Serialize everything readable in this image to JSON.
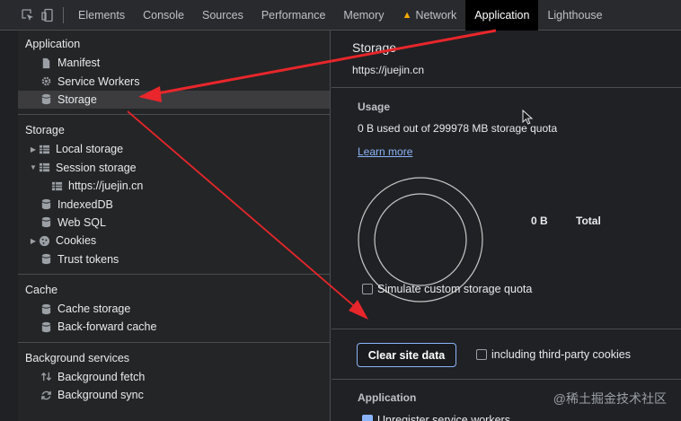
{
  "toolbar": {
    "tabs": [
      {
        "label": "Elements"
      },
      {
        "label": "Console"
      },
      {
        "label": "Sources"
      },
      {
        "label": "Performance"
      },
      {
        "label": "Memory"
      },
      {
        "label": "Network"
      },
      {
        "label": "Application"
      },
      {
        "label": "Lighthouse"
      }
    ],
    "active_tab": "Application"
  },
  "sidebar": {
    "application": {
      "heading": "Application",
      "items": [
        {
          "label": "Manifest",
          "icon": "file-icon"
        },
        {
          "label": "Service Workers",
          "icon": "gear-icon"
        },
        {
          "label": "Storage",
          "icon": "database-icon",
          "selected": true
        }
      ]
    },
    "storage": {
      "heading": "Storage",
      "items": [
        {
          "label": "Local storage",
          "icon": "grid-icon",
          "expander": "collapsed"
        },
        {
          "label": "Session storage",
          "icon": "grid-icon",
          "expander": "expanded"
        },
        {
          "label": "https://juejin.cn",
          "icon": "grid-icon",
          "child": true
        },
        {
          "label": "IndexedDB",
          "icon": "database-icon"
        },
        {
          "label": "Web SQL",
          "icon": "database-icon"
        },
        {
          "label": "Cookies",
          "icon": "cookie-icon",
          "expander": "collapsed"
        },
        {
          "label": "Trust tokens",
          "icon": "database-icon"
        }
      ]
    },
    "cache": {
      "heading": "Cache",
      "items": [
        {
          "label": "Cache storage",
          "icon": "database-icon"
        },
        {
          "label": "Back-forward cache",
          "icon": "database-icon"
        }
      ]
    },
    "background": {
      "heading": "Background services",
      "items": [
        {
          "label": "Background fetch",
          "icon": "arrows-updown-icon"
        },
        {
          "label": "Background sync",
          "icon": "sync-icon"
        }
      ]
    }
  },
  "main": {
    "title": "Storage",
    "origin": "https://juejin.cn",
    "usage": {
      "heading": "Usage",
      "text": "0 B used out of 299978 MB storage quota",
      "learn_more": "Learn more",
      "legend_value": "0 B",
      "legend_label": "Total"
    },
    "simulate_quota_label": "Simulate custom storage quota",
    "clear_button": "Clear site data",
    "third_party_label": "including third-party cookies",
    "application_heading": "Application",
    "unregister_label": "Unregister service workers"
  },
  "watermark": "@稀土掘金技术社区",
  "colors": {
    "accent": "#8ab4f8",
    "annotation_arrow": "#e8262b",
    "warning": "#f9ab00"
  }
}
